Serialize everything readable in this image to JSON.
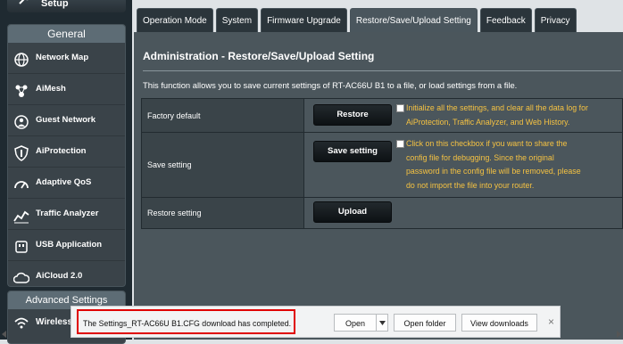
{
  "sidebar": {
    "setup_label": "Setup",
    "general_title": "General",
    "items": [
      {
        "label": "Network Map",
        "icon": "globe-icon"
      },
      {
        "label": "AiMesh",
        "icon": "aimesh-icon"
      },
      {
        "label": "Guest Network",
        "icon": "guest-network-icon"
      },
      {
        "label": "AiProtection",
        "icon": "shield-icon"
      },
      {
        "label": "Adaptive QoS",
        "icon": "gauge-icon"
      },
      {
        "label": "Traffic Analyzer",
        "icon": "chart-icon"
      },
      {
        "label": "USB Application",
        "icon": "usb-icon"
      },
      {
        "label": "AiCloud 2.0",
        "icon": "cloud-icon"
      }
    ],
    "advanced_title": "Advanced Settings",
    "advanced_first_item": "Wireless"
  },
  "tabs": [
    {
      "label": "Operation Mode",
      "active": false
    },
    {
      "label": "System",
      "active": false
    },
    {
      "label": "Firmware Upgrade",
      "active": false
    },
    {
      "label": "Restore/Save/Upload Setting",
      "active": true
    },
    {
      "label": "Feedback",
      "active": false
    },
    {
      "label": "Privacy",
      "active": false
    }
  ],
  "main": {
    "title": "Administration - Restore/Save/Upload Setting",
    "description": "This function allows you to save current settings of RT-AC66U B1 to a file, or load settings from a file.",
    "rows": [
      {
        "label": "Factory default",
        "button": "Restore",
        "note": "Initialize all the settings, and clear all the data log for AiProtection, Traffic Analyzer, and Web History."
      },
      {
        "label": "Save setting",
        "button": "Save setting",
        "note": "Click on this checkbox if you want to share the config file for debugging. Since the original password in the config file will be removed, please do not import the file into your router."
      },
      {
        "label": "Restore setting",
        "button": "Upload"
      }
    ]
  },
  "download_bar": {
    "message": "The Settings_RT-AC66U B1.CFG download has completed.",
    "open_label": "Open",
    "open_folder_label": "Open folder",
    "view_downloads_label": "View downloads",
    "close_label": "×"
  },
  "colors": {
    "note_text": "#f5c242",
    "highlight_border": "#e00000",
    "panel_bg": "#4b565c"
  }
}
